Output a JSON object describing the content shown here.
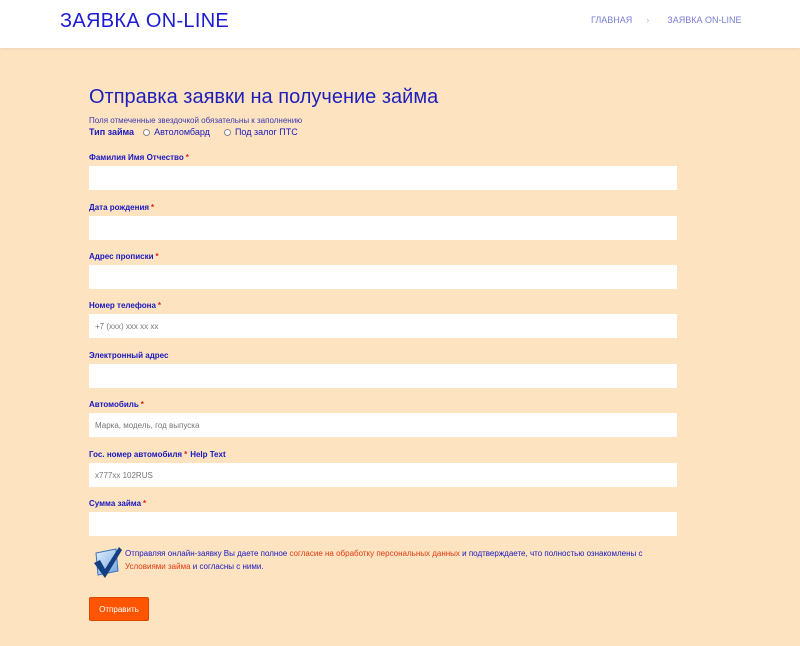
{
  "header": {
    "site_title": "ЗАЯВКА ON-LINE",
    "breadcrumb": {
      "home": "ГЛАВНАЯ",
      "separator": "›",
      "current": "ЗАЯВКА ON-LINE"
    }
  },
  "form": {
    "title": "Отправка заявки на получение займа",
    "required_note": "Поля отмеченные звездочкой обязательны к заполнению",
    "loan_type": {
      "label": "Тип займа",
      "options": [
        "Автоломбард",
        "Под залог ПТС"
      ]
    },
    "fields": [
      {
        "label": "Фамилия Имя Отчество",
        "star": "*",
        "help": "",
        "value": "",
        "placeholder": ""
      },
      {
        "label": "Дата рождения",
        "star": "*",
        "help": "",
        "value": "",
        "placeholder": ""
      },
      {
        "label": "Адрес прописки",
        "star": "*",
        "help": "",
        "value": "",
        "placeholder": ""
      },
      {
        "label": "Номер телефона",
        "star": "*",
        "help": "",
        "value": "",
        "placeholder": "+7 (xxx) xxx xx xx"
      },
      {
        "label": "Электронный адрес",
        "star": "",
        "help": "",
        "value": "",
        "placeholder": ""
      },
      {
        "label": "Автомобиль",
        "star": "*",
        "help": "",
        "value": "",
        "placeholder": "Марка, модель, год выпуска"
      },
      {
        "label": "Гос. номер автомобиля",
        "star": "*",
        "help": "Help Text",
        "value": "",
        "placeholder": "x777xx 102RUS"
      },
      {
        "label": "Сумма займа",
        "star": "*",
        "help": "",
        "value": "",
        "placeholder": ""
      }
    ],
    "consent": {
      "text1": "Отправляя онлайн-заявку Вы даете полное ",
      "link1": "согласие на обработку персональных данных",
      "text2": " и подтверждаете, что полностью ознакомлены с ",
      "link2": "Условиями займа",
      "text3": " и согласны с ними."
    },
    "submit_label": "Отправить"
  },
  "colors": {
    "background": "#fee3c1",
    "primary_text": "#1818c0",
    "required_star": "#e02020",
    "link": "#e03a10",
    "submit": "#ff5500"
  }
}
